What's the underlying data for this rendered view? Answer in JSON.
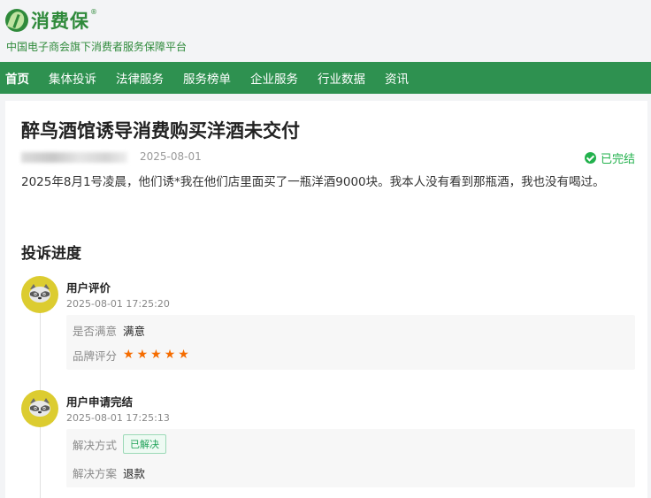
{
  "header": {
    "logo_text": "消费保",
    "logo_mark": "®",
    "tagline": "中国电子商会旗下消费者服务保障平台"
  },
  "nav": {
    "items": [
      {
        "label": "首页",
        "active": true
      },
      {
        "label": "集体投诉"
      },
      {
        "label": "法律服务"
      },
      {
        "label": "服务榜单"
      },
      {
        "label": "企业服务"
      },
      {
        "label": "行业数据"
      },
      {
        "label": "资讯"
      }
    ]
  },
  "complaint": {
    "title": "醉鸟酒馆诱导消费购买洋酒未交付",
    "date": "2025-08-01",
    "status": "已完结",
    "description": "2025年8月1号凌晨，他们诱*我在他们店里面买了一瓶洋酒9000块。我本人没有看到那瓶酒，我也没有喝过。"
  },
  "progress": {
    "section_title": "投诉进度",
    "entries": [
      {
        "title": "用户评价",
        "time": "2025-08-01 17:25:20",
        "rows": [
          {
            "label": "是否满意",
            "value": "满意"
          },
          {
            "label": "品牌评分",
            "stars": 5
          }
        ]
      },
      {
        "title": "用户申请完结",
        "time": "2025-08-01 17:25:13",
        "rows": [
          {
            "label": "解决方式",
            "badge": "已解决"
          },
          {
            "label": "解决方案",
            "value": "退款"
          }
        ]
      }
    ]
  },
  "colors": {
    "brand_green": "#2f8a3b",
    "nav_green": "#2e9150",
    "status_green": "#22b14c",
    "star_orange": "#f56c00"
  },
  "icons": {
    "logo": "leaf-logo-icon",
    "status": "check-circle-icon",
    "avatar": "raccoon-avatar-icon",
    "rating": "star-icon"
  }
}
